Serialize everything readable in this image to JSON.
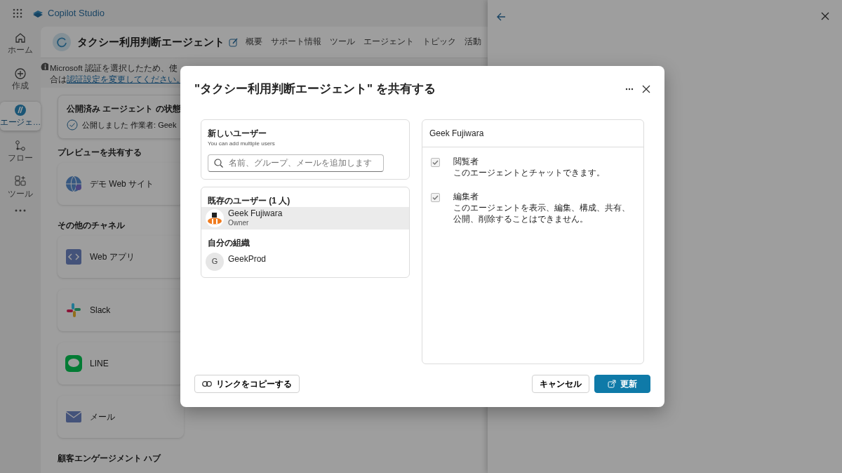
{
  "app": {
    "title": "Copilot Studio"
  },
  "rail": [
    {
      "label": "ホーム",
      "selected": false
    },
    {
      "label": "作成",
      "selected": false
    },
    {
      "label": "エージェ…",
      "selected": true
    },
    {
      "label": "フロー",
      "selected": false
    },
    {
      "label": "ツール",
      "selected": false
    }
  ],
  "agent": {
    "name": "タクシー利用判断エージェント",
    "tabs": [
      {
        "label": "概要",
        "selected": false
      },
      {
        "label": "サポート情報",
        "selected": false
      },
      {
        "label": "ツール",
        "selected": false
      },
      {
        "label": "エージェント",
        "selected": false
      },
      {
        "label": "トピック",
        "selected": false
      },
      {
        "label": "活動",
        "selected": false
      }
    ]
  },
  "banner": {
    "text": "Microsoft 認証を選択したため、使",
    "prefix": "合は",
    "link": "認証設定を変更してください。"
  },
  "status_card": {
    "title": "公開済み エージェント の状態",
    "status": "公開しました 作業者: Geek"
  },
  "sections": [
    {
      "heading": "プレビューを共有する",
      "channels": [
        {
          "name": "デモ Web サイト"
        }
      ]
    },
    {
      "heading": "その他のチャネル",
      "channels": [
        {
          "name": "Web アプリ"
        },
        {
          "name": "Slack"
        },
        {
          "name": "LINE"
        },
        {
          "name": "メール"
        }
      ]
    },
    {
      "heading": "顧客エンゲージメント ハブ"
    }
  ],
  "dialog": {
    "title": "\"タクシー利用判断エージェント\" を共有する",
    "new_users": {
      "heading": "新しいユーザー",
      "hint": "You can add multiple users",
      "placeholder": "名前、グループ、メールを追加します"
    },
    "existing": {
      "heading": "既存のユーザー (1 人)",
      "users": [
        {
          "name": "Geek Fujiwara",
          "role": "Owner",
          "selected": true
        }
      ]
    },
    "org": {
      "heading": "自分の組織",
      "items": [
        {
          "name": "GeekProd",
          "initial": "G",
          "selected": false
        }
      ]
    },
    "permissions": {
      "user": "Geek Fujiwara",
      "roles": [
        {
          "title": "閲覧者",
          "desc": "このエージェントとチャットできます。",
          "checked": true,
          "disabled": true
        },
        {
          "title": "編集者",
          "desc": "このエージェントを表示、編集、構成、共有、公開、削除することはできません。",
          "checked": true,
          "disabled": true
        }
      ]
    },
    "copy_link": "リンクをコピーする",
    "cancel": "キャンセル",
    "update": "更新"
  }
}
